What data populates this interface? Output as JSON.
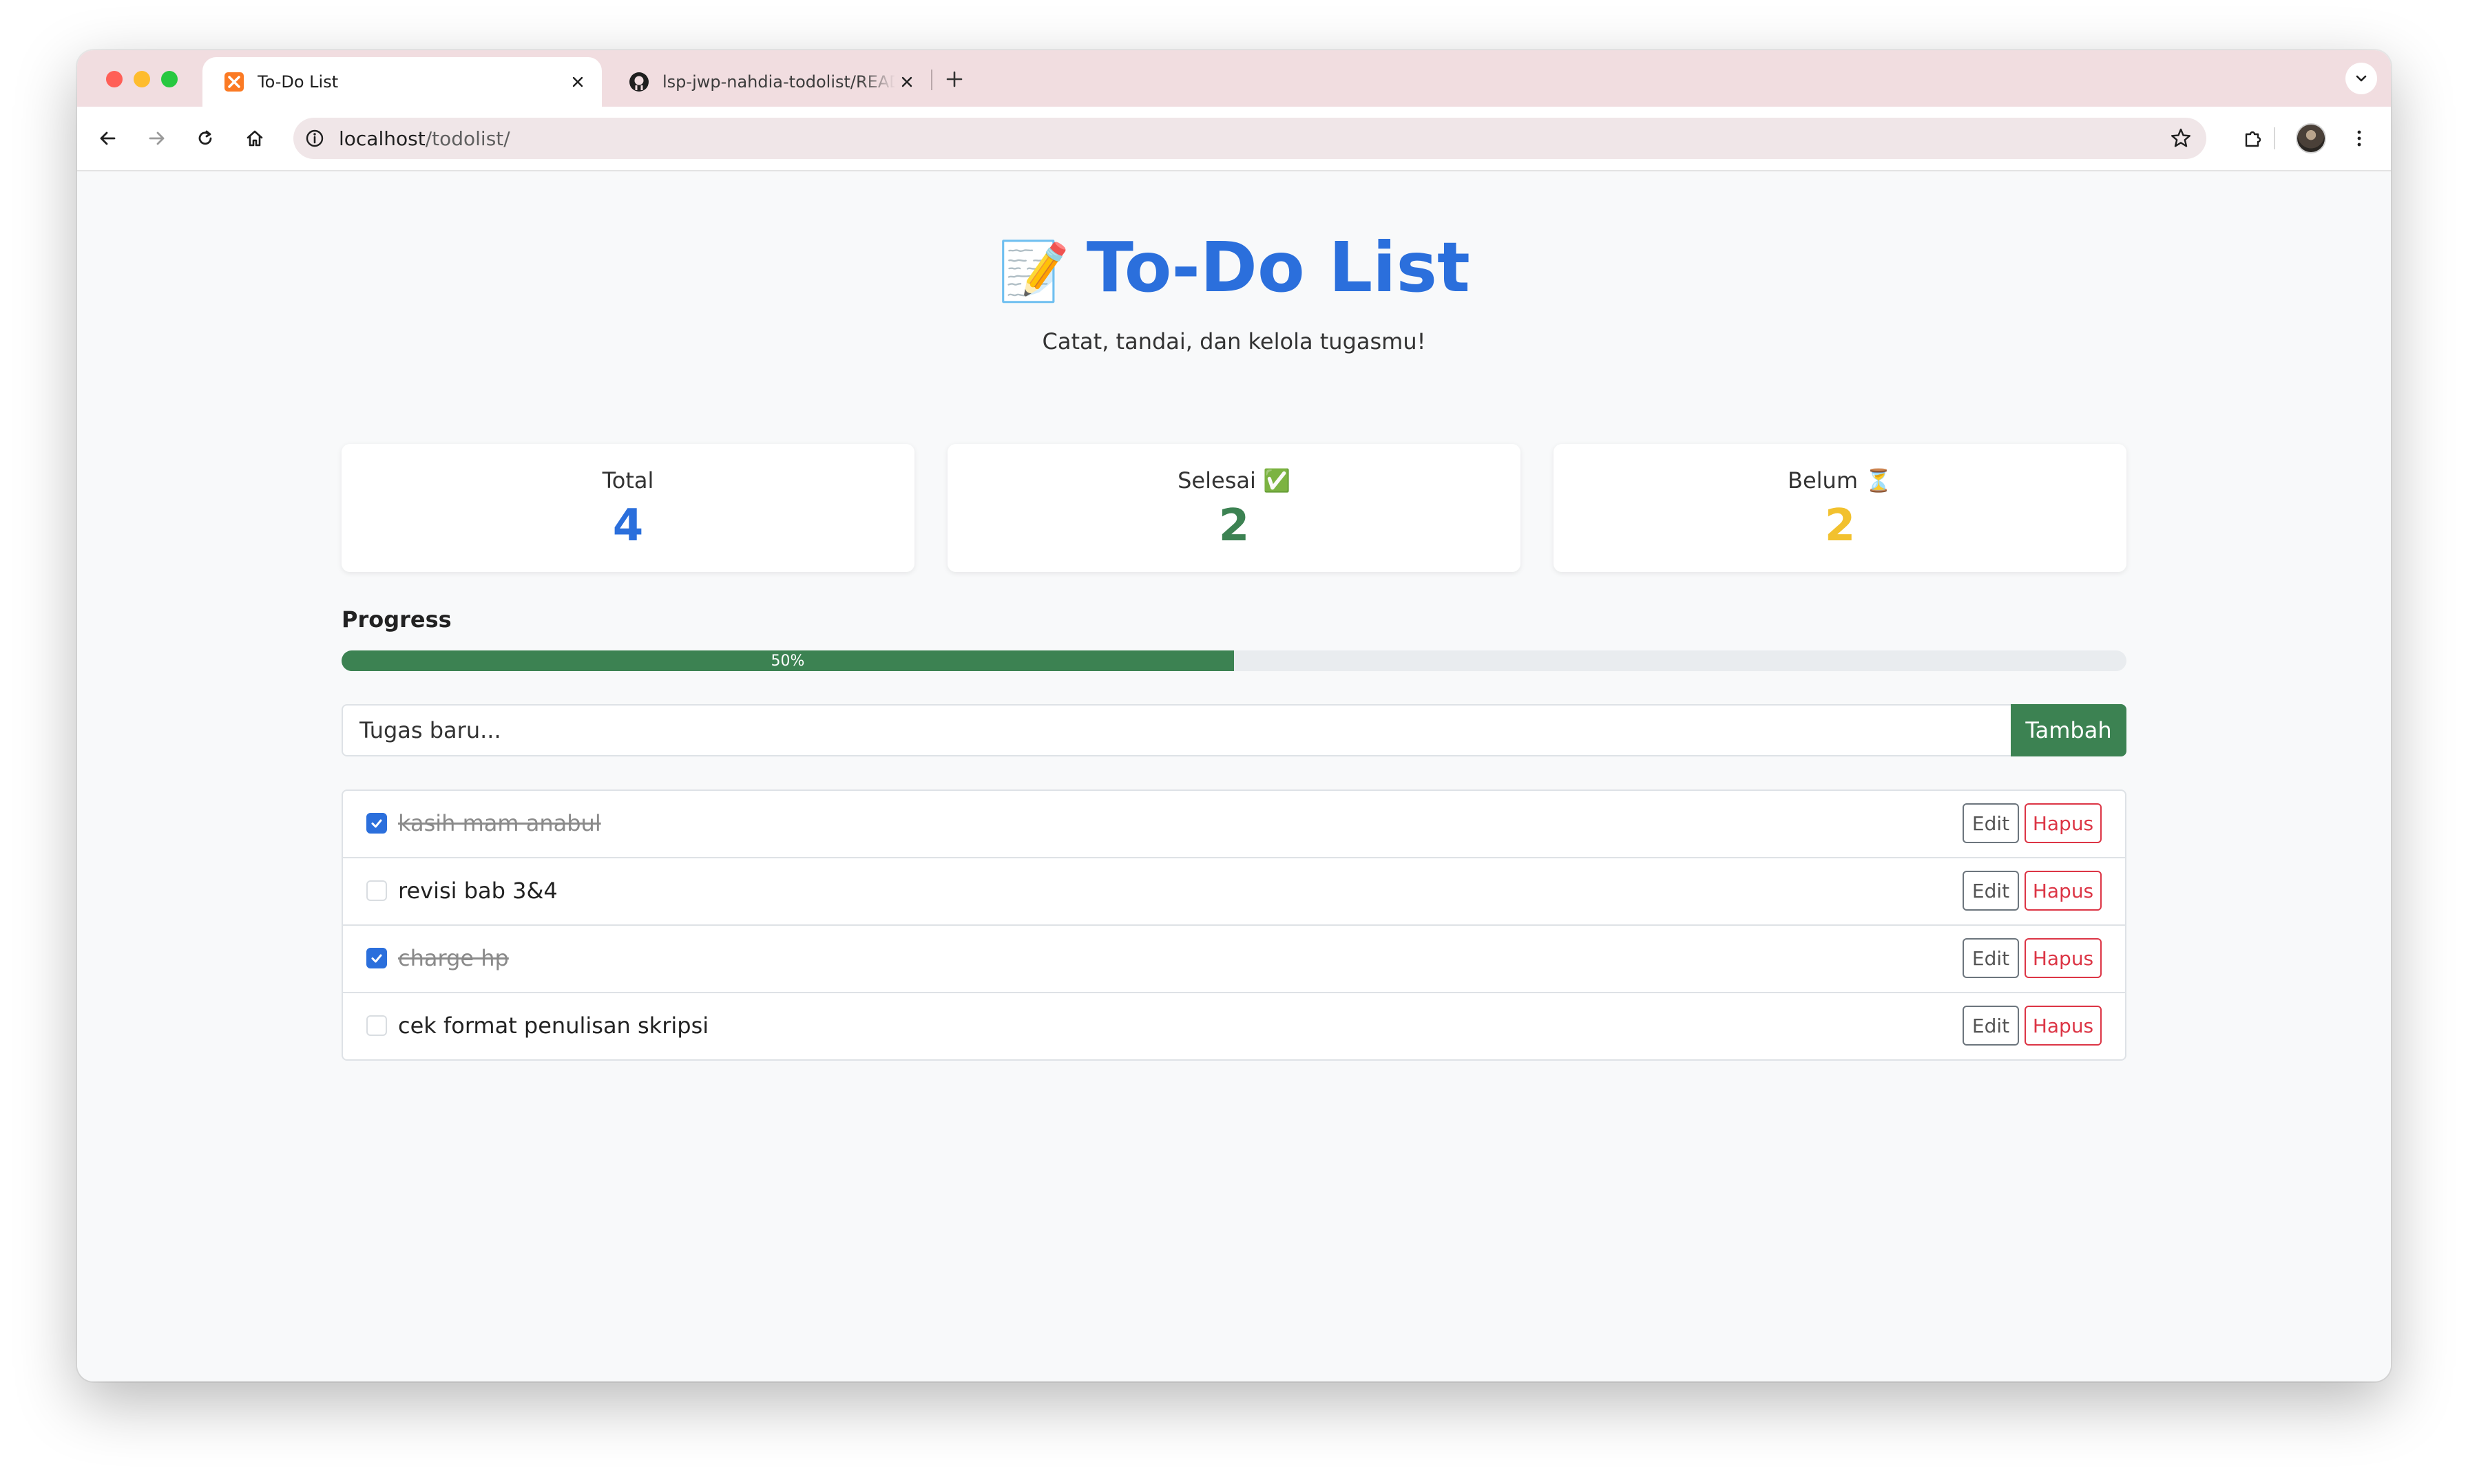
{
  "browser": {
    "tabs": [
      {
        "title": "To-Do List",
        "favicon": "xampp-icon",
        "active": true
      },
      {
        "title": "lsp-jwp-nahdia-todolist/README.md",
        "favicon": "github-icon",
        "active": false
      }
    ],
    "url_host": "localhost",
    "url_path": "/todolist/"
  },
  "page": {
    "title_emoji": "📝",
    "title": "To-Do List",
    "subtitle": "Catat, tandai, dan kelola tugasmu!"
  },
  "stats": {
    "total": {
      "label": "Total",
      "value": "4",
      "color": "#2b6fdc"
    },
    "done": {
      "label": "Selesai ✅",
      "value": "2",
      "color": "#3c8252"
    },
    "pending": {
      "label": "Belum ⏳",
      "value": "2",
      "color": "#f2c12e"
    }
  },
  "progress": {
    "label": "Progress",
    "percent": 50,
    "percent_text": "50%"
  },
  "add_form": {
    "placeholder": "Tugas baru...",
    "button_label": "Tambah"
  },
  "tasks": [
    {
      "text": "kasih mam anabul",
      "done": true,
      "edit_label": "Edit",
      "delete_label": "Hapus"
    },
    {
      "text": "revisi bab 3&4",
      "done": false,
      "edit_label": "Edit",
      "delete_label": "Hapus"
    },
    {
      "text": "charge hp",
      "done": true,
      "edit_label": "Edit",
      "delete_label": "Hapus"
    },
    {
      "text": "cek format penulisan skripsi",
      "done": false,
      "edit_label": "Edit",
      "delete_label": "Hapus"
    }
  ]
}
